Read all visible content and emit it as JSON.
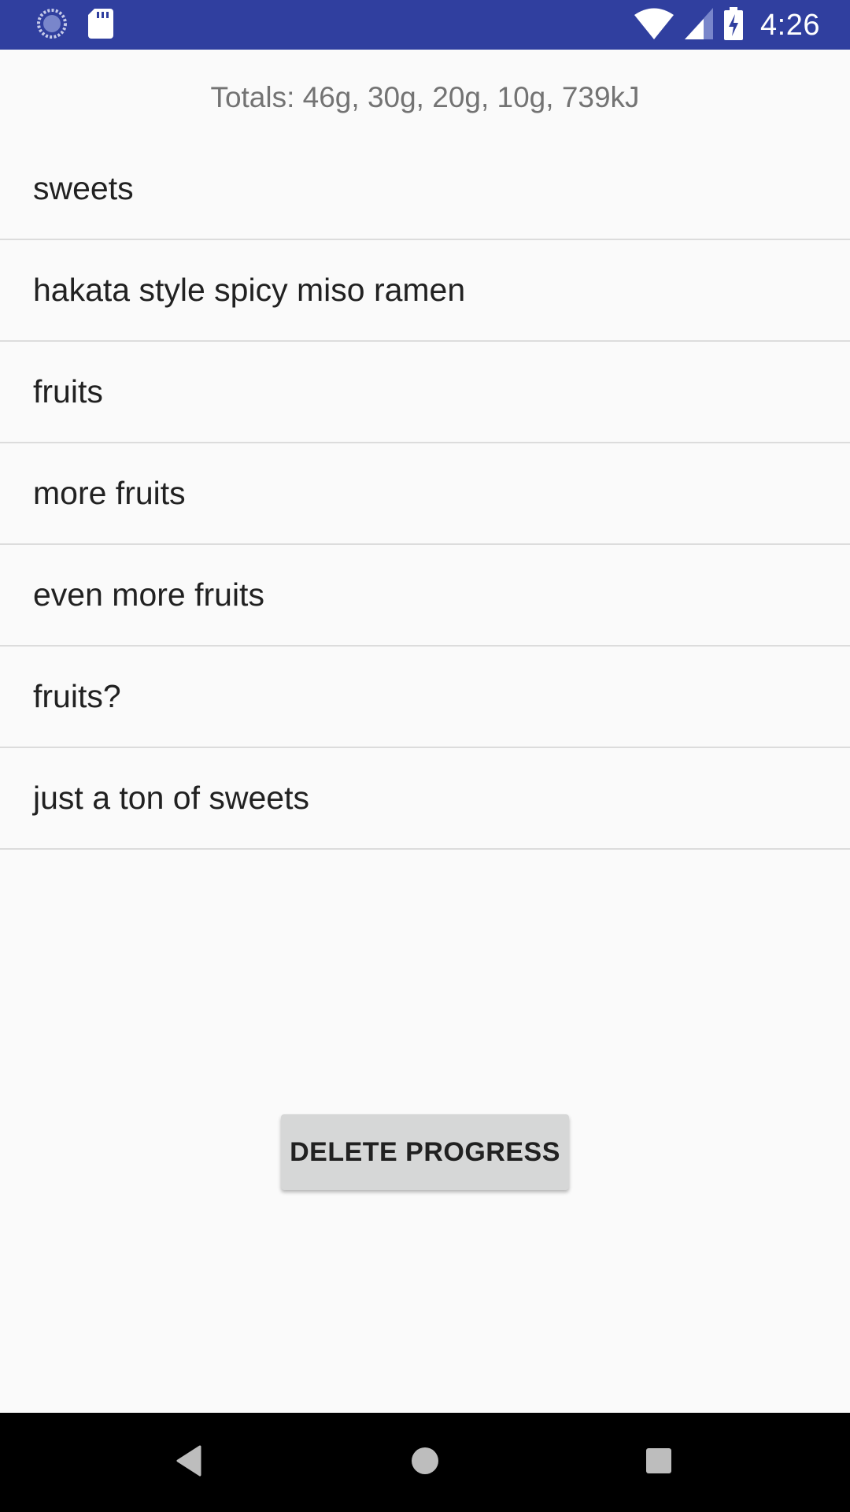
{
  "status_bar": {
    "time": "4:26",
    "icons": [
      "sync-icon",
      "sd-card-icon",
      "wifi-icon",
      "signal-icon",
      "battery-charging-icon"
    ]
  },
  "totals": "Totals: 46g, 30g, 20g, 10g, 739kJ",
  "food_items": [
    "sweets",
    "hakata style spicy miso ramen",
    "fruits",
    "more fruits",
    "even more fruits",
    "fruits?",
    "just a ton of sweets"
  ],
  "delete_button": {
    "label": "DELETE PROGRESS"
  },
  "nav_bar": {
    "icons": [
      "back-icon",
      "home-icon",
      "recents-icon"
    ]
  },
  "colors": {
    "status_bar": "#303f9f",
    "background": "#fafafa",
    "button": "#d6d7d7",
    "divider": "#dcdcdc"
  }
}
